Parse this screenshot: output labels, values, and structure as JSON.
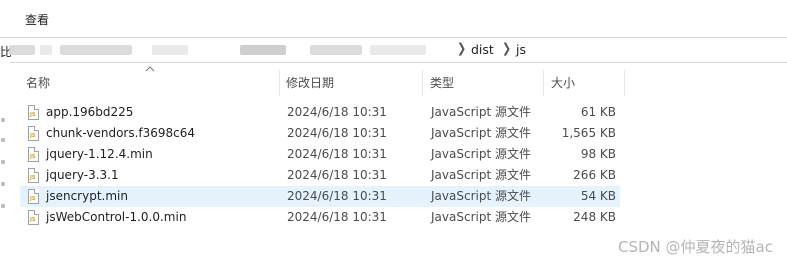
{
  "menu": {
    "view_label": "查看"
  },
  "address": {
    "prefix": "比",
    "crumbs": [
      "dist",
      "js"
    ]
  },
  "columns": {
    "name": "名称",
    "date": "修改日期",
    "type": "类型",
    "size": "大小"
  },
  "files": [
    {
      "name": "app.196bd225",
      "date": "2024/6/18 10:31",
      "type": "JavaScript 源文件",
      "size": "61 KB",
      "selected": false
    },
    {
      "name": "chunk-vendors.f3698c64",
      "date": "2024/6/18 10:31",
      "type": "JavaScript 源文件",
      "size": "1,565 KB",
      "selected": false
    },
    {
      "name": "jquery-1.12.4.min",
      "date": "2024/6/18 10:31",
      "type": "JavaScript 源文件",
      "size": "98 KB",
      "selected": false
    },
    {
      "name": "jquery-3.3.1",
      "date": "2024/6/18 10:31",
      "type": "JavaScript 源文件",
      "size": "266 KB",
      "selected": false
    },
    {
      "name": "jsencrypt.min",
      "date": "2024/6/18 10:31",
      "type": "JavaScript 源文件",
      "size": "54 KB",
      "selected": true
    },
    {
      "name": "jsWebControl-1.0.0.min",
      "date": "2024/6/18 10:31",
      "type": "JavaScript 源文件",
      "size": "248 KB",
      "selected": false
    }
  ],
  "icons": {
    "file_icon": "js-file-icon",
    "file_badge": "JS",
    "sort_indicator": "sort-ascending-icon"
  },
  "colors": {
    "selected_row": "#e5f3ff",
    "header_text": "#4c4c4c"
  },
  "watermark": "CSDN @仲夏夜的猫ac"
}
